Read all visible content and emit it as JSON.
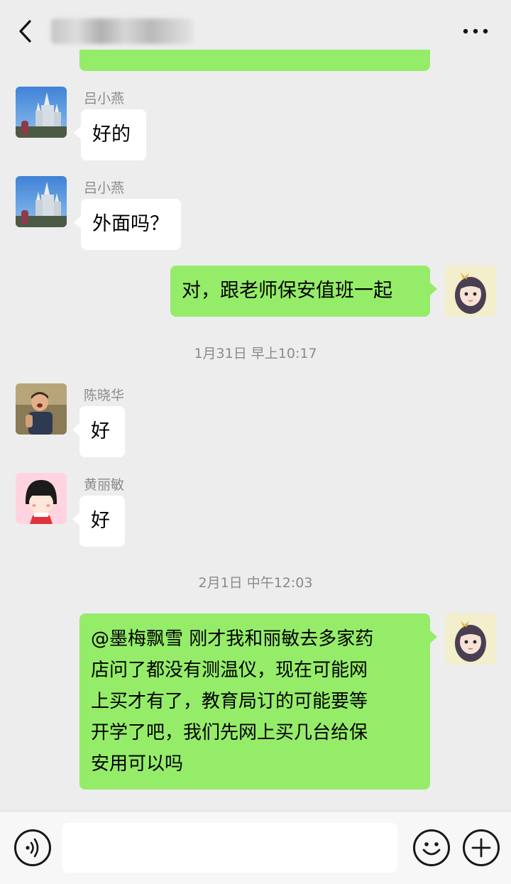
{
  "header": {
    "back_icon": "chevron-left-icon",
    "title_obscured": true,
    "more_icon": "more-dots-icon"
  },
  "messages": [
    {
      "sender": "吕小燕",
      "direction": "in",
      "text": "好的",
      "avatar": "castle-photo-avatar"
    },
    {
      "sender": "吕小燕",
      "direction": "in",
      "text": "外面吗？",
      "avatar": "castle-photo-avatar"
    },
    {
      "direction": "out",
      "text": "对，跟老师保安值班一起",
      "avatar": "cartoon-girl-avatar"
    },
    {
      "type": "timestamp",
      "text": "1月31日 早上10:17"
    },
    {
      "sender": "陈晓华",
      "direction": "in",
      "text": "好",
      "avatar": "child-photo-avatar"
    },
    {
      "sender": "黄丽敏",
      "direction": "in",
      "text": "好",
      "avatar": "cartoon-maruko-avatar"
    },
    {
      "type": "timestamp",
      "text": "2月1日 中午12:03"
    },
    {
      "direction": "out",
      "lines": [
        "@墨梅飘雪  刚才我和丽敏去多家药",
        "店问了都没有测温仪，现在可能网",
        "上买才有了，教育局订的可能要等",
        "开学了吧，我们先网上买几台给保",
        "安用可以吗"
      ],
      "avatar": "cartoon-girl-avatar"
    }
  ],
  "bottom_bar": {
    "voice_icon": "voice-icon",
    "input_value": "",
    "emoji_icon": "emoji-icon",
    "plus_icon": "plus-icon"
  },
  "colors": {
    "background": "#ededed",
    "outgoing_bubble": "#95ec69",
    "incoming_bubble": "#ffffff",
    "meta_text": "#8a8a8a"
  }
}
